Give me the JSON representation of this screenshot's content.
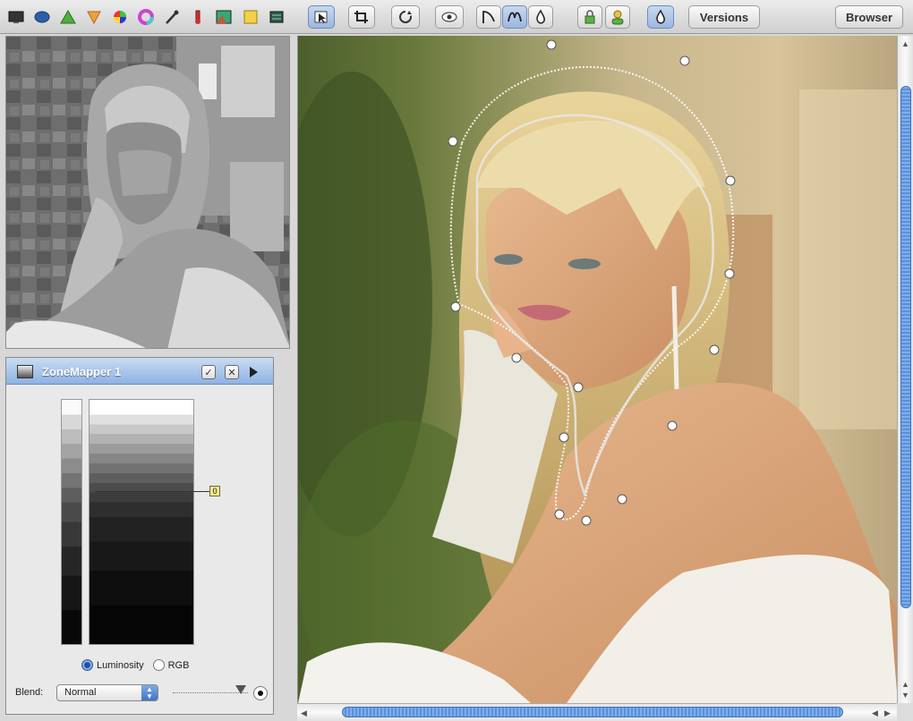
{
  "toolbar": {
    "tools": [
      {
        "name": "monitor-tool",
        "icon": "monitor-icon"
      },
      {
        "name": "ellipse-tool",
        "icon": "blue-blob-icon"
      },
      {
        "name": "green-triangle-tool",
        "icon": "green-triangle-icon"
      },
      {
        "name": "orange-funnel-tool",
        "icon": "orange-funnel-icon"
      },
      {
        "name": "color-balance-tool",
        "icon": "color-wheel-icon"
      },
      {
        "name": "hue-tool",
        "icon": "hue-wheel-icon"
      },
      {
        "name": "eyedropper-tool",
        "icon": "eyedropper-icon"
      },
      {
        "name": "thermometer-tool",
        "icon": "thermometer-icon"
      },
      {
        "name": "image-tool",
        "icon": "image-icon"
      },
      {
        "name": "notes-tool",
        "icon": "notes-icon"
      },
      {
        "name": "layers-tool",
        "icon": "layers-icon"
      }
    ],
    "versions_label": "Versions",
    "browser_label": "Browser"
  },
  "panel": {
    "title": "ZoneMapper 1",
    "pin_label": "0",
    "mode_luminosity": "Luminosity",
    "mode_rgb": "RGB",
    "selected_mode": "Luminosity",
    "blend_label": "Blend:",
    "blend_value": "Normal"
  },
  "colors": {
    "panel_header": "#9fbde6",
    "scroll_thumb": "#5a90dc",
    "selection_path": "#ffffff"
  }
}
